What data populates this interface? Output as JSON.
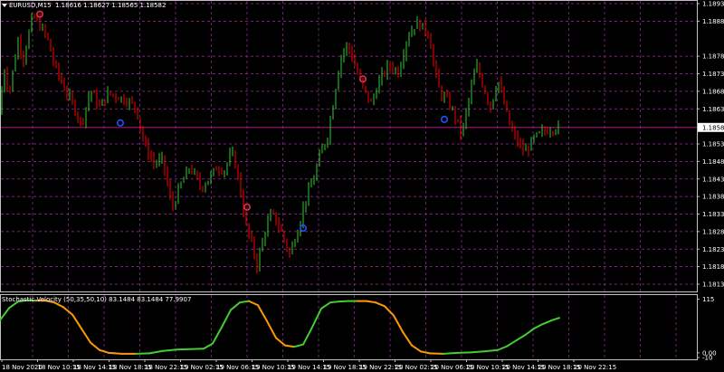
{
  "chart_header": {
    "symbol_label": "EURUSD,M15",
    "ohlc": "1.18616 1.18627 1.18565 1.18582"
  },
  "indicator_header": {
    "label": "Stochastic Velocity (50,35,50,10) 83.1484 83.1484 77.9907"
  },
  "colors": {
    "bull": "#32cd32",
    "bear": "#ff0000",
    "grid": "#9b30a0",
    "level_line": "#c8209a",
    "arrow_down": "#e0304a",
    "arrow_up": "#2050ff",
    "osc_up": "#44cc33",
    "osc_down": "#ff9900"
  },
  "chart_data": [
    {
      "type": "candlestick",
      "y_axis_labels": [
        "1.18935",
        "1.18885",
        "1.18785",
        "1.18735",
        "1.18685",
        "1.18635",
        "1.18535",
        "1.18485",
        "1.18435",
        "1.18385",
        "1.18335",
        "1.18285",
        "1.18235",
        "1.18185",
        "1.18135"
      ],
      "ylim": [
        1.18135,
        1.18935
      ],
      "current_price": "1.18582",
      "time_labels": [
        "18 Nov 2020",
        "18 Nov 10:15",
        "18 Nov 14:15",
        "18 Nov 18:15",
        "18 Nov 22:15",
        "19 Nov 02:15",
        "19 Nov 06:15",
        "19 Nov 10:15",
        "19 Nov 14:15",
        "19 Nov 18:15",
        "19 Nov 22:15",
        "20 Nov 02:15",
        "20 Nov 06:15",
        "20 Nov 10:15",
        "20 Nov 14:15",
        "20 Nov 18:15",
        "20 Nov 22:15"
      ],
      "price_path": [
        [
          0,
          1.1862
        ],
        [
          4,
          1.1876
        ],
        [
          10,
          1.1868
        ],
        [
          20,
          1.1883
        ],
        [
          26,
          1.1878
        ],
        [
          36,
          1.189
        ],
        [
          42,
          1.1888
        ],
        [
          52,
          1.1884
        ],
        [
          60,
          1.1876
        ],
        [
          70,
          1.187
        ],
        [
          80,
          1.1865
        ],
        [
          90,
          1.1859
        ],
        [
          100,
          1.1869
        ],
        [
          110,
          1.1864
        ],
        [
          120,
          1.1868
        ],
        [
          130,
          1.1867
        ],
        [
          140,
          1.1866
        ],
        [
          150,
          1.1864
        ],
        [
          160,
          1.1853
        ],
        [
          170,
          1.1848
        ],
        [
          180,
          1.1849
        ],
        [
          190,
          1.1835
        ],
        [
          200,
          1.1842
        ],
        [
          210,
          1.1847
        ],
        [
          222,
          1.1841
        ],
        [
          232,
          1.1844
        ],
        [
          240,
          1.1847
        ],
        [
          248,
          1.1846
        ],
        [
          256,
          1.1851
        ],
        [
          262,
          1.1846
        ],
        [
          268,
          1.1836
        ],
        [
          272,
          1.183
        ],
        [
          278,
          1.1825
        ],
        [
          284,
          1.1819
        ],
        [
          292,
          1.1828
        ],
        [
          300,
          1.1834
        ],
        [
          310,
          1.1829
        ],
        [
          320,
          1.1822
        ],
        [
          330,
          1.183
        ],
        [
          338,
          1.1838
        ],
        [
          346,
          1.1843
        ],
        [
          352,
          1.1849
        ],
        [
          362,
          1.1856
        ],
        [
          368,
          1.1865
        ],
        [
          376,
          1.1878
        ],
        [
          384,
          1.1882
        ],
        [
          392,
          1.1876
        ],
        [
          400,
          1.187
        ],
        [
          410,
          1.1865
        ],
        [
          420,
          1.1872
        ],
        [
          430,
          1.1876
        ],
        [
          440,
          1.1874
        ],
        [
          450,
          1.1884
        ],
        [
          460,
          1.1888
        ],
        [
          466,
          1.1887
        ],
        [
          474,
          1.1885
        ],
        [
          480,
          1.1875
        ],
        [
          486,
          1.1868
        ],
        [
          494,
          1.1866
        ],
        [
          502,
          1.1862
        ],
        [
          510,
          1.1856
        ],
        [
          518,
          1.1866
        ],
        [
          526,
          1.1876
        ],
        [
          534,
          1.187
        ],
        [
          542,
          1.1864
        ],
        [
          550,
          1.1872
        ],
        [
          556,
          1.1866
        ],
        [
          564,
          1.1858
        ],
        [
          572,
          1.1854
        ],
        [
          580,
          1.1851
        ],
        [
          590,
          1.1855
        ],
        [
          600,
          1.1857
        ],
        [
          610,
          1.1858
        ],
        [
          618,
          1.18582
        ]
      ],
      "markers": [
        {
          "type": "sell-arrow",
          "x_index": 44,
          "price": 1.18905
        },
        {
          "type": "buy-arrow",
          "x_index": 133,
          "price": 1.18595
        },
        {
          "type": "sell-arrow",
          "x_index": 273,
          "price": 1.18355
        },
        {
          "type": "buy-arrow",
          "x_index": 335,
          "price": 1.18295
        },
        {
          "type": "sell-arrow",
          "x_index": 401,
          "price": 1.1872
        },
        {
          "type": "buy-arrow",
          "x_index": 491,
          "price": 1.18605
        }
      ]
    },
    {
      "type": "line",
      "name": "Stochastic Velocity (50,35,50,10)",
      "y_axis_labels": [
        "115",
        "0.00",
        "-10"
      ],
      "ylim": [
        -10,
        120
      ],
      "values_at_x": [
        [
          0,
          70
        ],
        [
          10,
          96
        ],
        [
          20,
          110
        ],
        [
          30,
          113
        ],
        [
          40,
          112
        ],
        [
          50,
          112
        ],
        [
          60,
          108
        ],
        [
          70,
          98
        ],
        [
          80,
          82
        ],
        [
          90,
          52
        ],
        [
          100,
          22
        ],
        [
          110,
          6
        ],
        [
          120,
          0
        ],
        [
          135,
          -2
        ],
        [
          150,
          -2
        ],
        [
          165,
          -1
        ],
        [
          180,
          4
        ],
        [
          195,
          7
        ],
        [
          210,
          8
        ],
        [
          225,
          9
        ],
        [
          235,
          20
        ],
        [
          245,
          55
        ],
        [
          255,
          92
        ],
        [
          265,
          108
        ],
        [
          275,
          111
        ],
        [
          285,
          102
        ],
        [
          295,
          68
        ],
        [
          305,
          32
        ],
        [
          315,
          16
        ],
        [
          325,
          13
        ],
        [
          335,
          18
        ],
        [
          345,
          55
        ],
        [
          355,
          95
        ],
        [
          365,
          108
        ],
        [
          375,
          110
        ],
        [
          385,
          111
        ],
        [
          395,
          111
        ],
        [
          405,
          111
        ],
        [
          415,
          108
        ],
        [
          425,
          100
        ],
        [
          435,
          80
        ],
        [
          445,
          45
        ],
        [
          455,
          16
        ],
        [
          465,
          3
        ],
        [
          475,
          -1
        ],
        [
          490,
          -2
        ],
        [
          505,
          0
        ],
        [
          520,
          1
        ],
        [
          535,
          3
        ],
        [
          550,
          6
        ],
        [
          560,
          14
        ],
        [
          570,
          26
        ],
        [
          580,
          38
        ],
        [
          590,
          52
        ],
        [
          600,
          62
        ],
        [
          610,
          70
        ],
        [
          618,
          75
        ]
      ],
      "direction_changes": [
        [
          0,
          "up"
        ],
        [
          40,
          "down"
        ],
        [
          150,
          "up"
        ],
        [
          275,
          "down"
        ],
        [
          325,
          "up"
        ],
        [
          395,
          "down"
        ],
        [
          490,
          "up"
        ]
      ]
    }
  ]
}
